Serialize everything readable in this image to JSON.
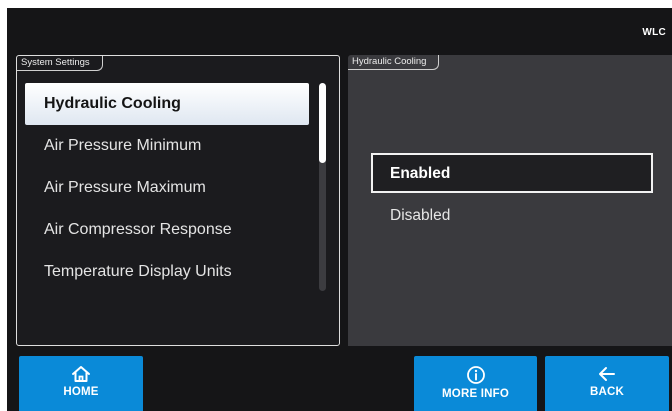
{
  "header": {
    "badge": "WLC"
  },
  "system_settings": {
    "title": "System Settings",
    "items": [
      {
        "label": "Hydraulic Cooling",
        "selected": true
      },
      {
        "label": "Air Pressure Minimum",
        "selected": false
      },
      {
        "label": "Air Pressure Maximum",
        "selected": false
      },
      {
        "label": "Air Compressor Response",
        "selected": false
      },
      {
        "label": "Temperature Display Units",
        "selected": false
      }
    ]
  },
  "detail": {
    "title": "Hydraulic Cooling",
    "options": [
      {
        "label": "Enabled",
        "selected": true
      },
      {
        "label": "Disabled",
        "selected": false
      }
    ]
  },
  "footer": {
    "home_label": "HOME",
    "more_info_label": "MORE INFO",
    "back_label": "BACK"
  },
  "icons": {
    "home": "home-icon",
    "more_info": "info-circle-icon",
    "back": "arrow-left-icon"
  },
  "colors": {
    "accent": "#0a8ad8",
    "screen_background": "#151517",
    "detail_panel": "#3a3a3e",
    "selected_item": "#ffffff"
  }
}
